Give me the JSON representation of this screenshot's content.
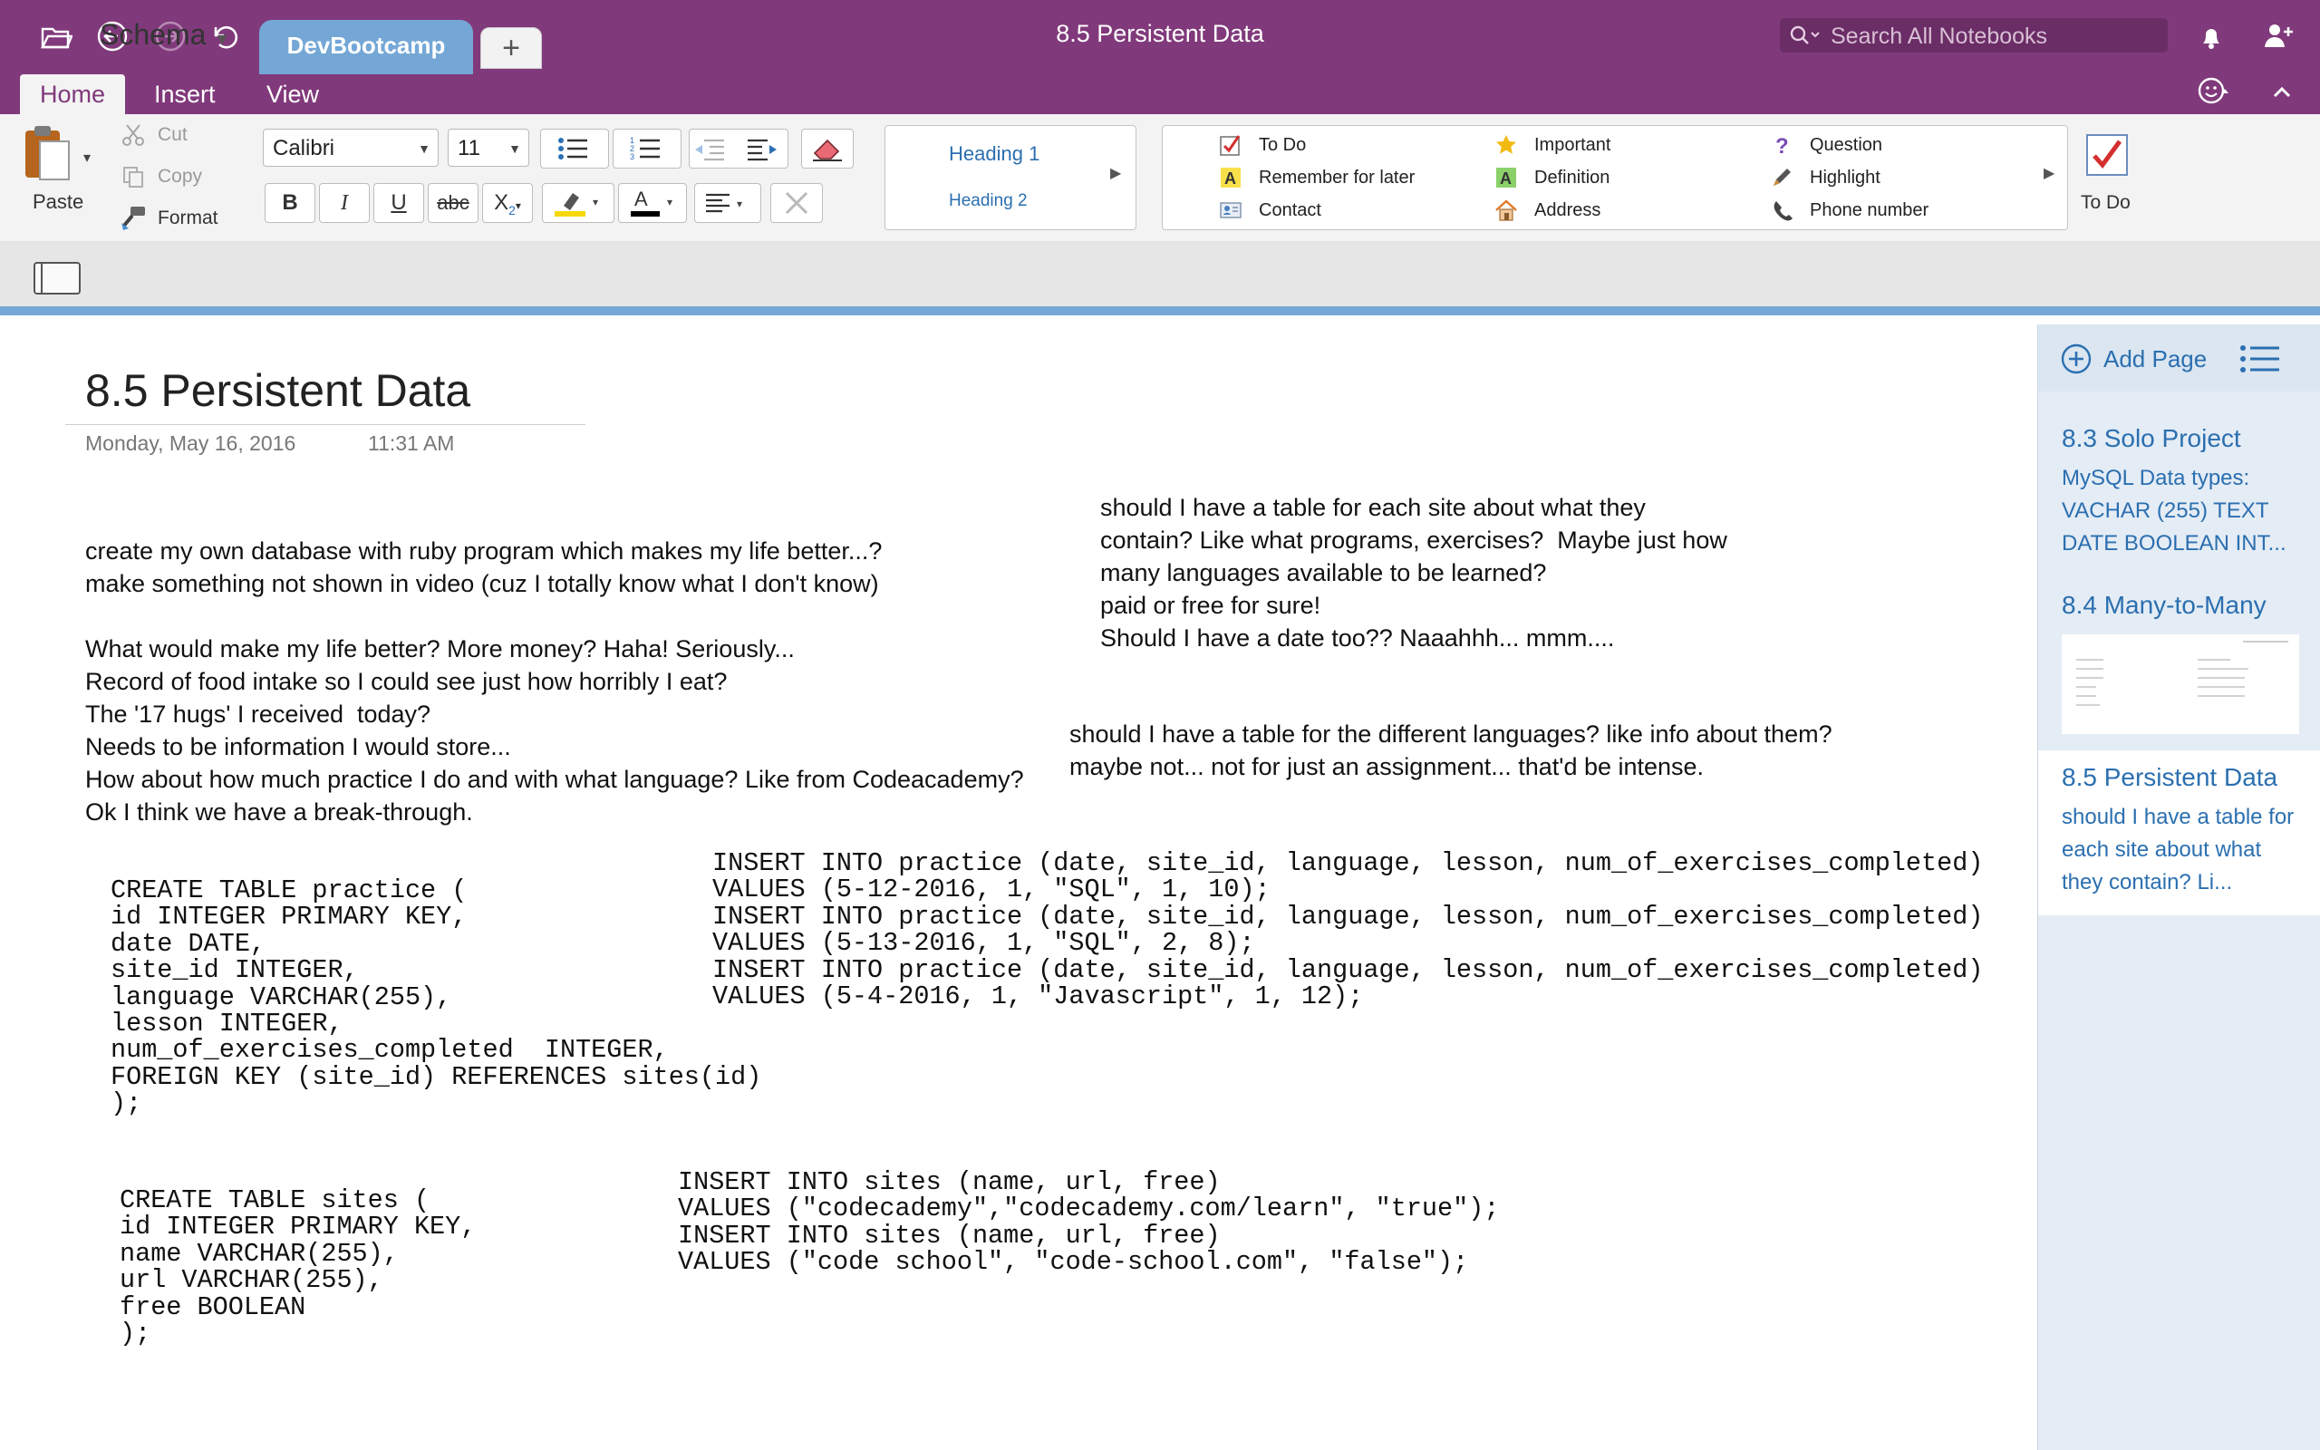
{
  "window": {
    "title": "8.5 Persistent Data"
  },
  "search": {
    "placeholder": "Search All Notebooks"
  },
  "ribbon_tabs": [
    "Home",
    "Insert",
    "View"
  ],
  "clipboard": {
    "paste": "Paste",
    "cut": "Cut",
    "copy": "Copy",
    "format": "Format"
  },
  "font": {
    "name": "Calibri",
    "size": "11"
  },
  "format_buttons": {
    "bold": "B",
    "italic": "I",
    "underline": "U",
    "strike": "abc",
    "subscript": "X",
    "highlight_color": "#f5d90a",
    "font_color": "#000000"
  },
  "styles": [
    "Heading 1",
    "Heading 2"
  ],
  "tags": [
    {
      "label": "To Do",
      "icon": "checkbox-icon"
    },
    {
      "label": "Remember for later",
      "icon": "letter-a-yellow-icon"
    },
    {
      "label": "Contact",
      "icon": "contact-card-icon"
    },
    {
      "label": "Important",
      "icon": "star-icon"
    },
    {
      "label": "Definition",
      "icon": "letter-a-green-icon"
    },
    {
      "label": "Address",
      "icon": "house-icon"
    },
    {
      "label": "Question",
      "icon": "question-mark-icon"
    },
    {
      "label": "Highlight",
      "icon": "pen-icon"
    },
    {
      "label": "Phone number",
      "icon": "phone-icon"
    }
  ],
  "todo_button": "To Do",
  "notebook": {
    "name": "Schema"
  },
  "section": {
    "name": "DevBootcamp",
    "add": "+"
  },
  "page": {
    "title": "8.5 Persistent Data",
    "date": "Monday, May 16, 2016",
    "time": "11:31 AM",
    "notes_left": "create my own database with ruby program which makes my life better...?\nmake something not shown in video (cuz I totally know what I don't know)\n\nWhat would make my life better? More money? Haha! Seriously...\nRecord of food intake so I could see just how horribly I eat?\nThe '17 hugs' I received  today?\nNeeds to be information I would store...\nHow about how much practice I do and with what language? Like from Codeacademy?\nOk I think we have a break-through.",
    "notes_right_1": "should I have a table for each site about what they\ncontain? Like what programs, exercises?  Maybe just how\nmany languages available to be learned?\npaid or free for sure!\nShould I have a date too?? Naaahhh... mmm....",
    "notes_right_2": "should I have a table for the different languages? like info about them?\nmaybe not... not for just an assignment... that'd be intense.",
    "code_create_practice": "CREATE TABLE practice (\nid INTEGER PRIMARY KEY,\ndate DATE,\nsite_id INTEGER,\nlanguage VARCHAR(255),\nlesson INTEGER,\nnum_of_exercises_completed  INTEGER,\nFOREIGN KEY (site_id) REFERENCES sites(id)\n);",
    "code_insert_practice": "INSERT INTO practice (date, site_id, language, lesson, num_of_exercises_completed)\nVALUES (5-12-2016, 1, \"SQL\", 1, 10);\nINSERT INTO practice (date, site_id, language, lesson, num_of_exercises_completed)\nVALUES (5-13-2016, 1, \"SQL\", 2, 8);\nINSERT INTO practice (date, site_id, language, lesson, num_of_exercises_completed)\nVALUES (5-4-2016, 1, \"Javascript\", 1, 12);",
    "code_create_sites": "CREATE TABLE sites (\nid INTEGER PRIMARY KEY,\nname VARCHAR(255),\nurl VARCHAR(255),\nfree BOOLEAN\n);",
    "code_insert_sites": "INSERT INTO sites (name, url, free)\nVALUES (\"codecademy\",\"codecademy.com/learn\", \"true\");\nINSERT INTO sites (name, url, free)\nVALUES (\"code school\", \"code-school.com\", \"false\");"
  },
  "pages_pane": {
    "add_page": "Add Page",
    "pages": [
      {
        "title": "8.3 Solo Project",
        "preview": "MySQL  Data types: VACHAR (255)  TEXT DATE  BOOLEAN  INT..."
      },
      {
        "title": "8.4 Many-to-Many",
        "preview": ""
      },
      {
        "title": "8.5 Persistent Data",
        "preview": "should I have a table for each site about what they contain? Li..."
      }
    ]
  },
  "colors": {
    "accent": "#80397b",
    "section": "#74a7d5",
    "link": "#2b6fb0"
  }
}
